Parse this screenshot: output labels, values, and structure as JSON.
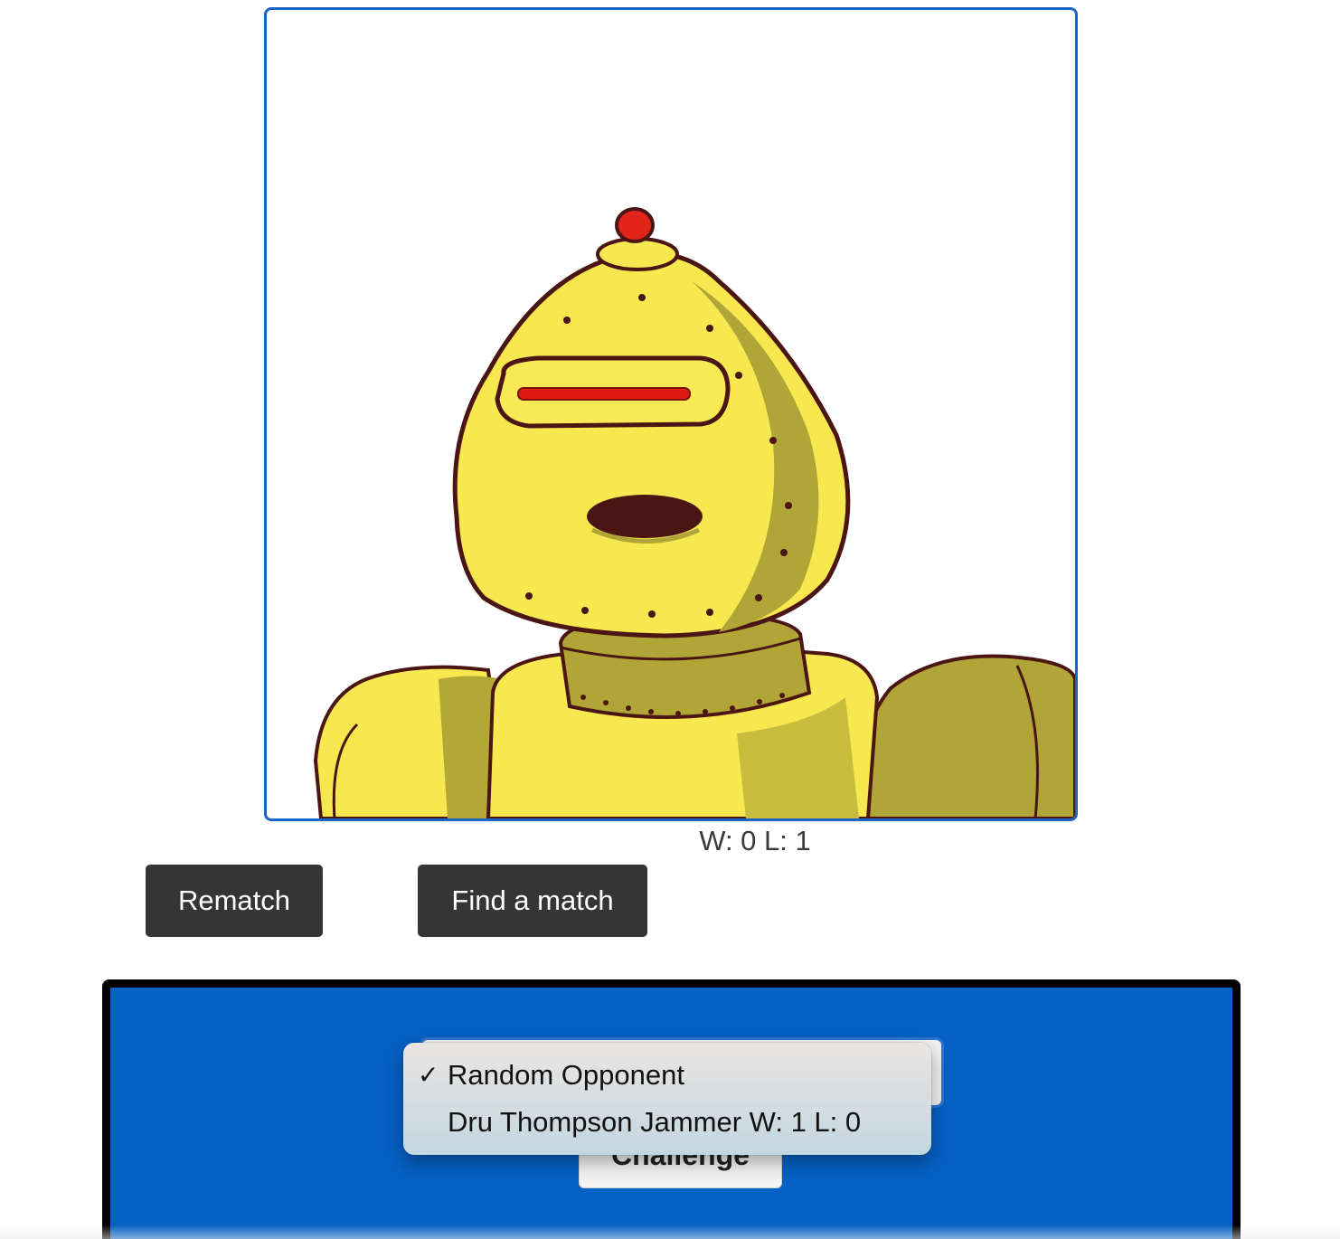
{
  "player": {
    "avatar_name": "robot-avatar",
    "record": "W: 0 L: 1"
  },
  "actions": {
    "rematch_label": "Rematch",
    "find_match_label": "Find a match"
  },
  "challenge": {
    "button_label": "Challenge",
    "opponent_options": [
      {
        "label": "Random Opponent",
        "selected": true
      },
      {
        "label": "Dru Thompson Jammer W: 1 L: 0",
        "selected": false
      }
    ],
    "check_mark": "✓"
  },
  "colors": {
    "frame_border": "#1d63c4",
    "panel_background": "#0561c4",
    "dark_button": "#353535",
    "robot_yellow": "#f8e84d",
    "robot_shadow": "#b0a536"
  }
}
